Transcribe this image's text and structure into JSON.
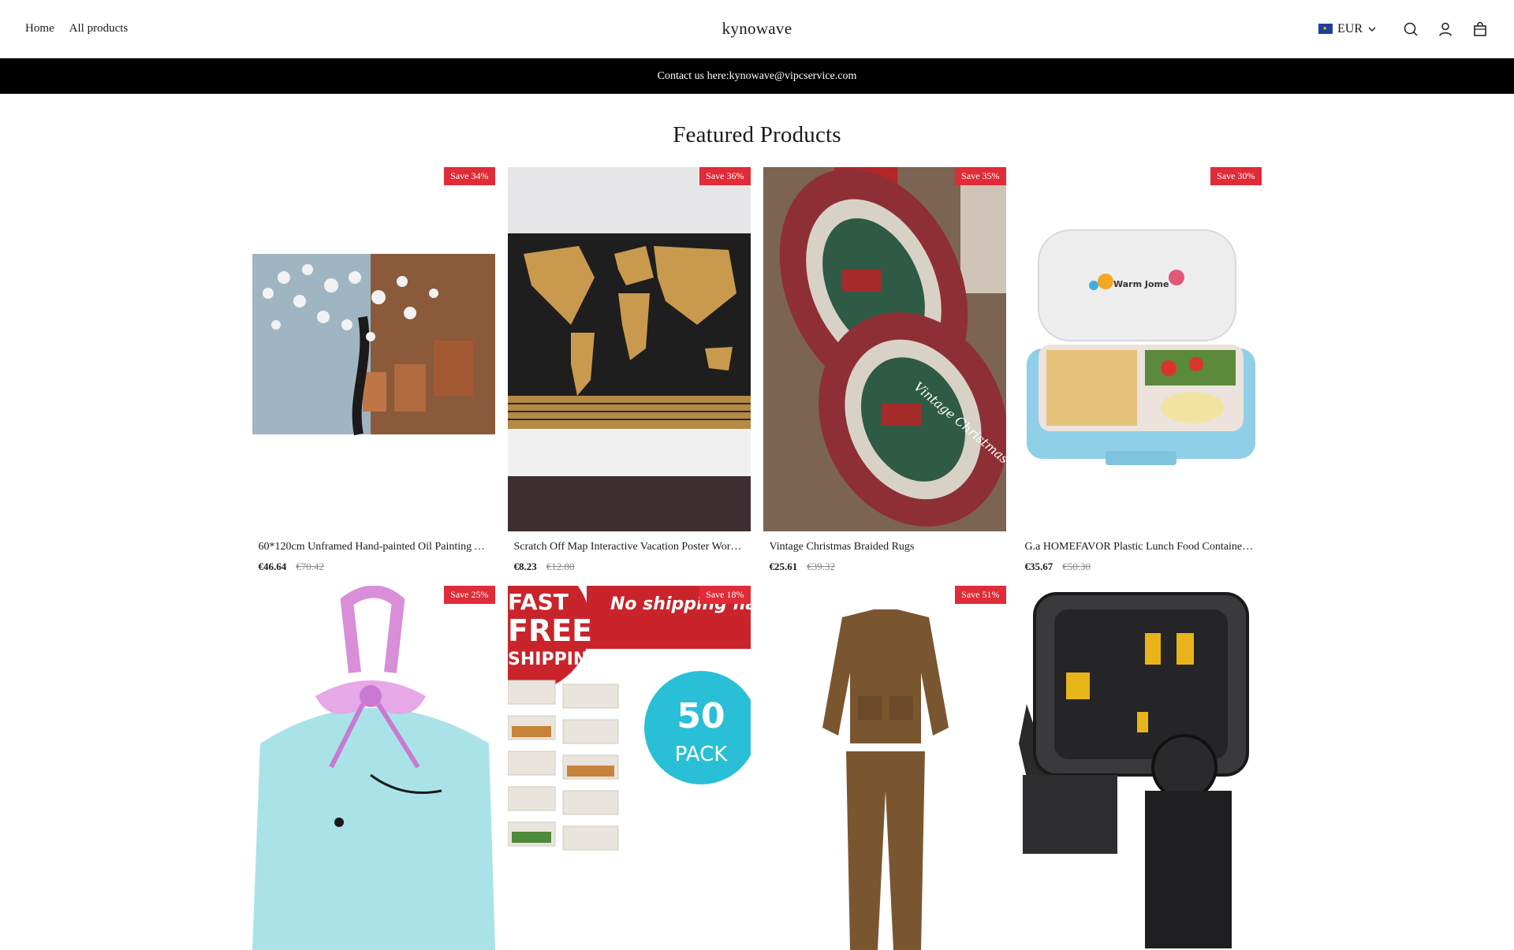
{
  "header": {
    "nav": [
      "Home",
      "All products"
    ],
    "brand": "kynowave",
    "currency": "EUR"
  },
  "announcement": "Contact us here:kynowave@vipcservice.com",
  "section_title": "Featured Products",
  "products": [
    {
      "badge": "Save 34%",
      "title": "60*120cm Unframed Hand-painted Oil Painting Abstract Tree",
      "price": "€46.64",
      "compare": "€70.42"
    },
    {
      "badge": "Save 36%",
      "title": "Scratch Off Map Interactive Vacation Poster World Map",
      "price": "€8.23",
      "compare": "€12.80"
    },
    {
      "badge": "Save 35%",
      "title": "Vintage Christmas Braided Rugs",
      "price": "€25.61",
      "compare": "€39.32"
    },
    {
      "badge": "Save 30%",
      "title": "G.a HOMEFAVOR Plastic Lunch Food Container Bento Box",
      "price": "€35.67",
      "compare": "€50.30"
    },
    {
      "badge": "Save 25%",
      "title": "",
      "price": "",
      "compare": ""
    },
    {
      "badge": "Save 18%",
      "title": "",
      "price": "",
      "compare": ""
    },
    {
      "badge": "Save 51%",
      "title": "",
      "price": "",
      "compare": ""
    },
    {
      "badge": "",
      "title": "",
      "price": "",
      "compare": ""
    }
  ],
  "image_text": {
    "lunchbox_brand": "Warm Jome",
    "containers_banner": "No shipping handling fe",
    "containers_free": "FREE",
    "containers_fast": "FAST",
    "containers_shipping": "SHIPPING",
    "containers_pack_num": "50",
    "containers_pack_word": "PACK",
    "rug_text": "Vintage Christmas"
  },
  "colors": {
    "badge": "#e02b38",
    "announcement_bg": "#000000",
    "text": "#1a1a1a",
    "compare_text": "#8a8a8a"
  }
}
